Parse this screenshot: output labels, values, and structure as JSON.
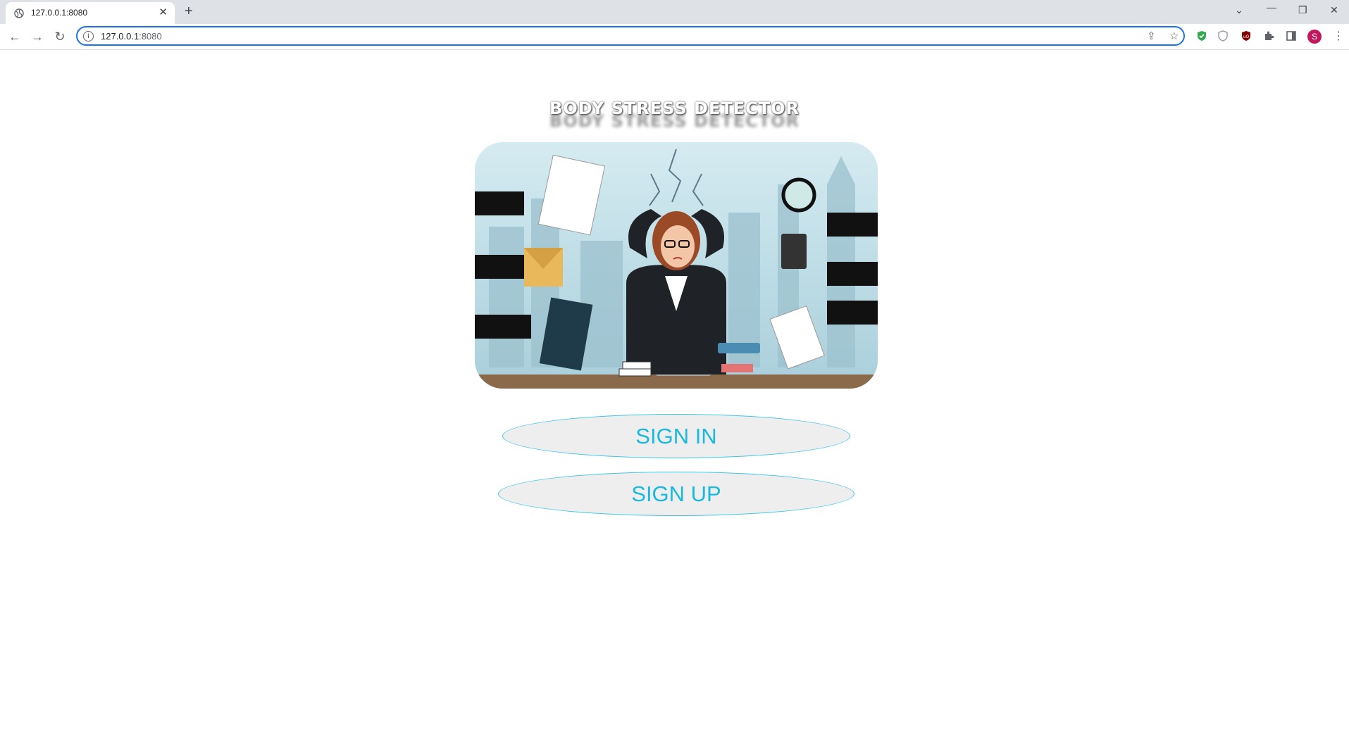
{
  "browser": {
    "tab_title": "127.0.0.1:8080",
    "url_host": "127.0.0.1",
    "url_port": ":8080",
    "profile_initial": "S"
  },
  "page": {
    "heading": "BODY STRESS DETECTOR",
    "sign_in_label": "SIGN IN",
    "sign_up_label": "SIGN UP"
  },
  "colors": {
    "accent": "#1ab9de",
    "button_bg": "#eeeeee",
    "button_border": "#3ec8e6"
  }
}
